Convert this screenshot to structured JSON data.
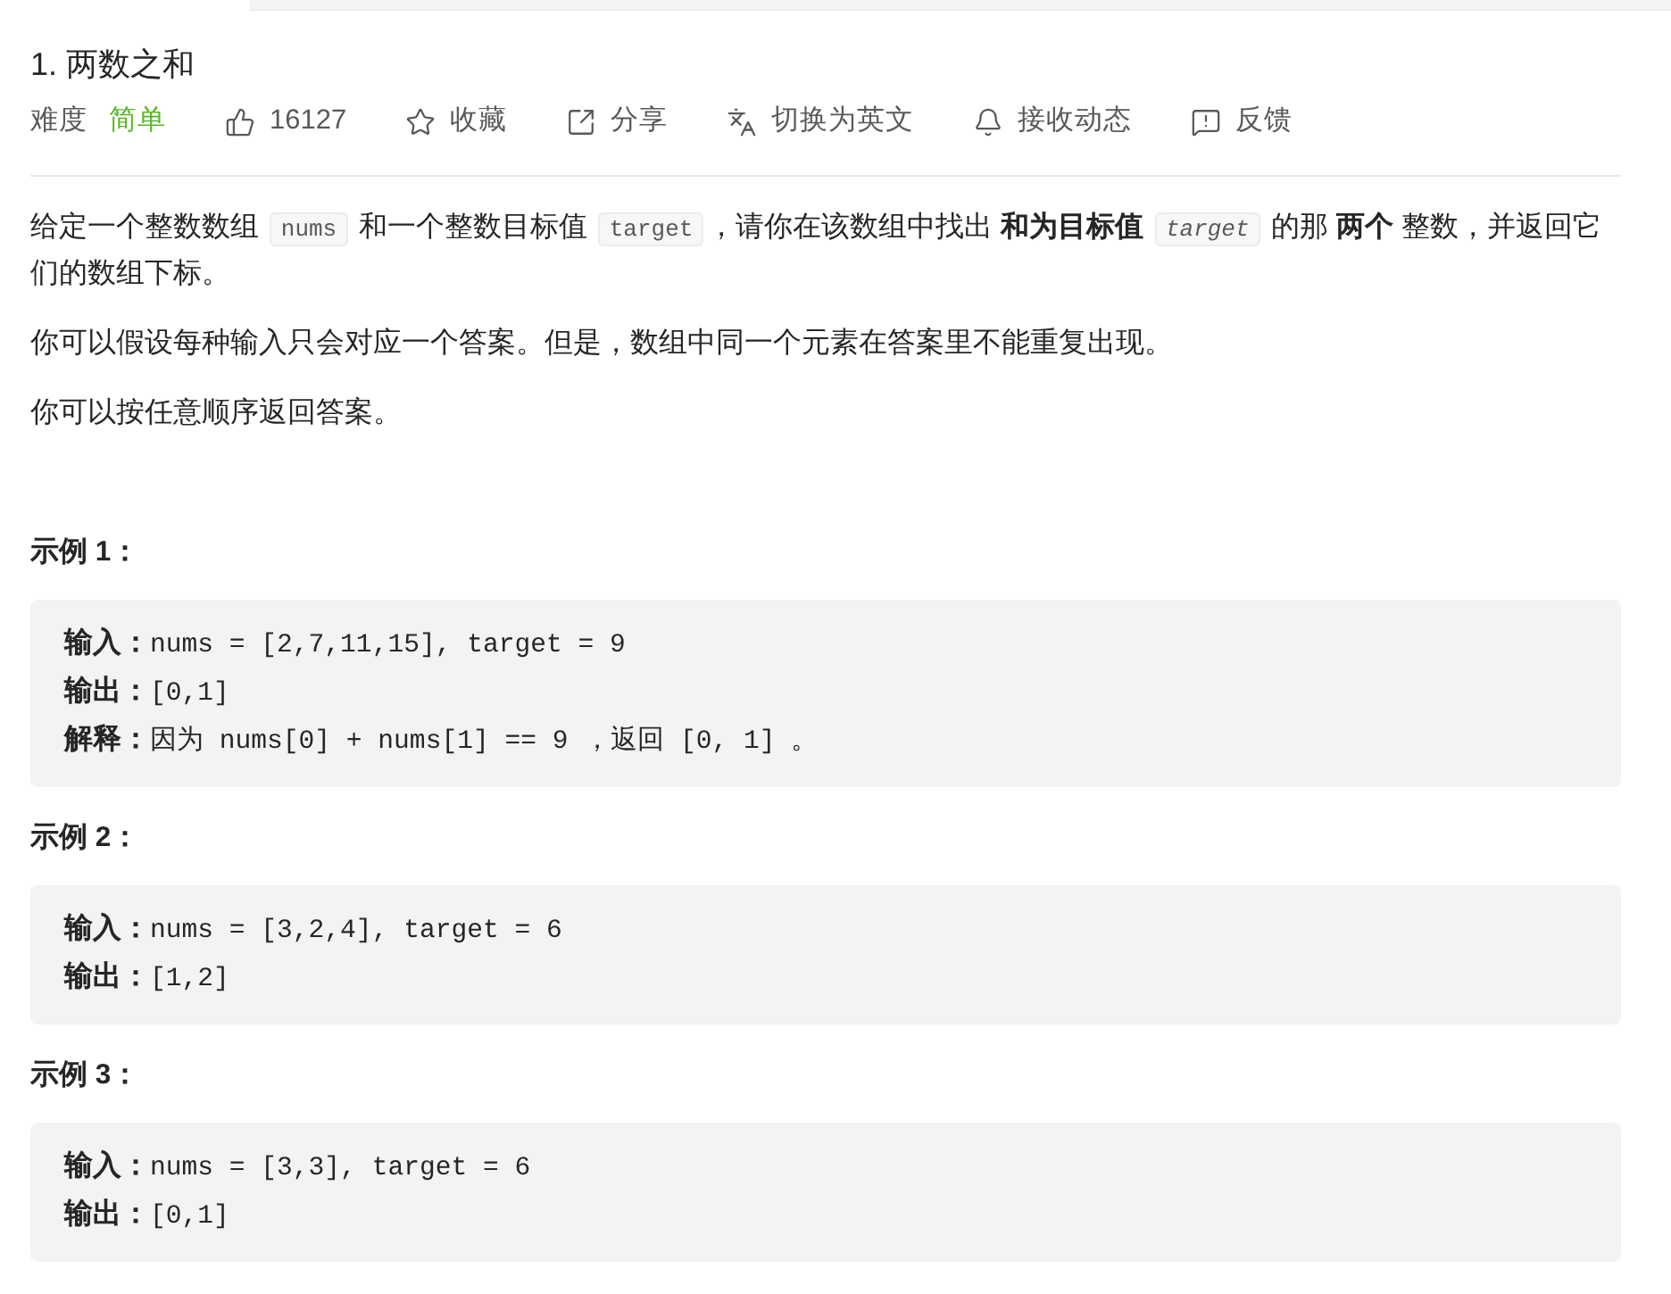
{
  "problem": {
    "title": "1. 两数之和",
    "difficulty": {
      "label": "难度",
      "value": "简单"
    },
    "actions": [
      {
        "kind": "like",
        "label": "16127"
      },
      {
        "kind": "favorite",
        "label": "收藏"
      },
      {
        "kind": "share",
        "label": "分享"
      },
      {
        "kind": "translate",
        "label": "切换为英文"
      },
      {
        "kind": "subscribe",
        "label": "接收动态"
      },
      {
        "kind": "feedback",
        "label": "反馈"
      }
    ]
  },
  "description": [
    [
      {
        "kind": "text",
        "text": "给定一个整数数组 "
      },
      {
        "kind": "code",
        "text": "nums",
        "italic": false
      },
      {
        "kind": "text",
        "text": " 和一个整数目标值 "
      },
      {
        "kind": "code",
        "text": "target",
        "italic": false
      },
      {
        "kind": "text",
        "text": "，请你在该数组中找出 **和为目标值** "
      },
      {
        "kind": "code",
        "text": "target",
        "italic": true
      },
      {
        "kind": "text",
        "text": " 的那 **两个** 整数，并返回它们的数组下标。"
      }
    ],
    [
      {
        "kind": "text",
        "text": "你可以假设每种输入只会对应一个答案。但是，数组中同一个元素在答案里不能重复出现。"
      }
    ],
    [
      {
        "kind": "text",
        "text": "你可以按任意顺序返回答案。"
      }
    ]
  ],
  "examples": [
    {
      "title": "示例 1：",
      "lines": [
        "**输入：**nums = [2,7,11,15], target = 9",
        "**输出：**[0,1]",
        "**解释：**因为 nums[0] + nums[1] == 9 ，返回 [0, 1] 。"
      ]
    },
    {
      "title": "示例 2：",
      "lines": [
        "**输入：**nums = [3,2,4], target = 6",
        "**输出：**[1,2]"
      ]
    },
    {
      "title": "示例 3：",
      "lines": [
        "**输入：**nums = [3,3], target = 6",
        "**输出：**[0,1]"
      ]
    }
  ]
}
